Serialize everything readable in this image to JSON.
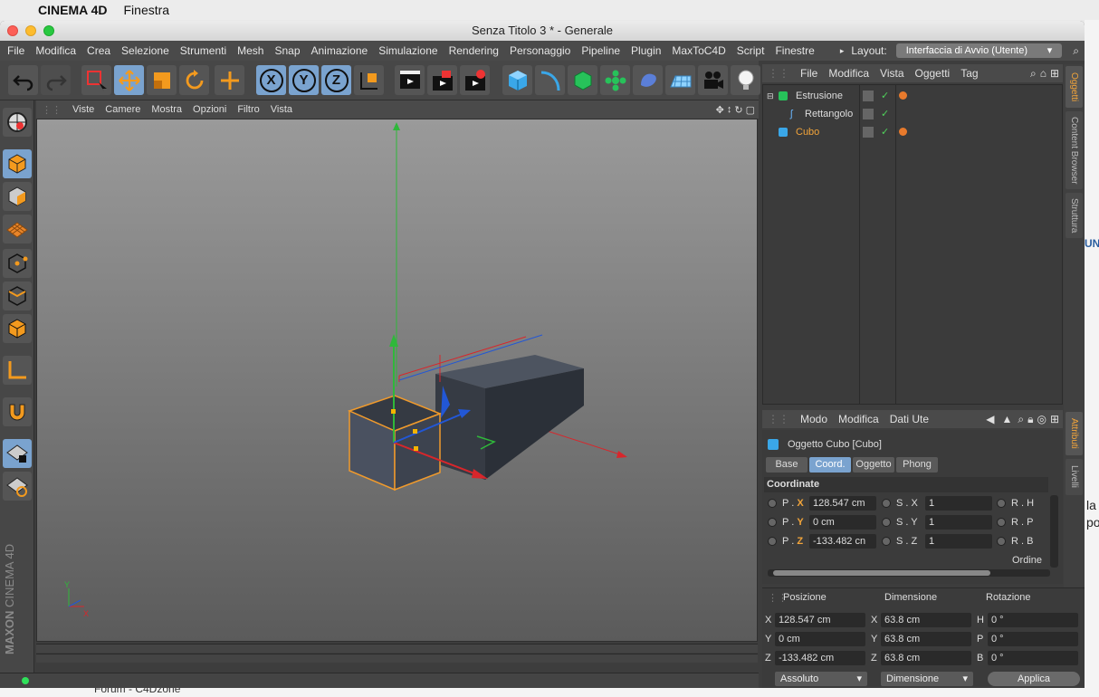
{
  "mac": {
    "app": "CINEMA 4D",
    "menu_window": "Finestra"
  },
  "window": {
    "title": "Senza Titolo 3 * - Generale"
  },
  "menubar": [
    "File",
    "Modifica",
    "Crea",
    "Selezione",
    "Strumenti",
    "Mesh",
    "Snap",
    "Animazione",
    "Simulazione",
    "Rendering",
    "Personaggio",
    "Pipeline",
    "Plugin",
    "MaxToC4D",
    "Script",
    "Finestre"
  ],
  "layout": {
    "label": "Layout:",
    "value": "Interfaccia di Avvio (Utente)"
  },
  "toolbar": {
    "axis_x": "X",
    "axis_y": "Y",
    "axis_z": "Z"
  },
  "viewport_menu": [
    "Viste",
    "Camere",
    "Mostra",
    "Opzioni",
    "Filtro",
    "Vista"
  ],
  "object_menu": [
    "File",
    "Modifica",
    "Vista",
    "Oggetti",
    "Tag"
  ],
  "objects": [
    {
      "name": "Estrusione",
      "selected": false
    },
    {
      "name": "Rettangolo",
      "selected": false
    },
    {
      "name": "Cubo",
      "selected": true
    }
  ],
  "side_tabs": {
    "oggetti": "Oggetti",
    "content_browser": "Content Browser",
    "struttura": "Struttura",
    "attributi": "Attributi",
    "livelli": "Livelli"
  },
  "attr_menu": [
    "Modo",
    "Modifica",
    "Dati Ute"
  ],
  "attr": {
    "object_title": "Oggetto Cubo [Cubo]",
    "tabs": [
      "Base",
      "Coord.",
      "Oggetto",
      "Phong"
    ],
    "active_tab": "Coord.",
    "section": "Coordinate",
    "p_labels": [
      "P . ",
      "P . ",
      "P . "
    ],
    "p_axes": [
      "X",
      "Y",
      "Z"
    ],
    "p_values": [
      "128.547 cm",
      "0 cm",
      "-133.482 cn"
    ],
    "s_labels": [
      "S . X",
      "S . Y",
      "S . Z"
    ],
    "s_values": [
      "1",
      "1",
      "1"
    ],
    "r_labels": [
      "R . H",
      "R . P",
      "R . B"
    ],
    "ordine": "Ordine"
  },
  "coord": {
    "headers": [
      "Posizione",
      "Dimensione",
      "Rotazione"
    ],
    "pos_labels": [
      "X",
      "Y",
      "Z"
    ],
    "pos": [
      "128.547 cm",
      "0 cm",
      "-133.482 cm"
    ],
    "dim_labels": [
      "X",
      "Y",
      "Z"
    ],
    "dim": [
      "63.8 cm",
      "63.8 cm",
      "63.8 cm"
    ],
    "rot_labels": [
      "H",
      "P",
      "B"
    ],
    "rot": [
      "0 °",
      "0 °",
      "0 °"
    ],
    "mode1": "Assoluto",
    "mode2": "Dimensione",
    "apply": "Applica"
  },
  "brand": {
    "maxon": "MAXON",
    "c4d": "CINEMA 4D"
  },
  "viewport_axes": {
    "y": "Y",
    "x": "X"
  },
  "background": {
    "tab": "Forum - C4Dzone",
    "right_text_1": "UN",
    "right_text_2": "la",
    "right_text_3": "po"
  }
}
